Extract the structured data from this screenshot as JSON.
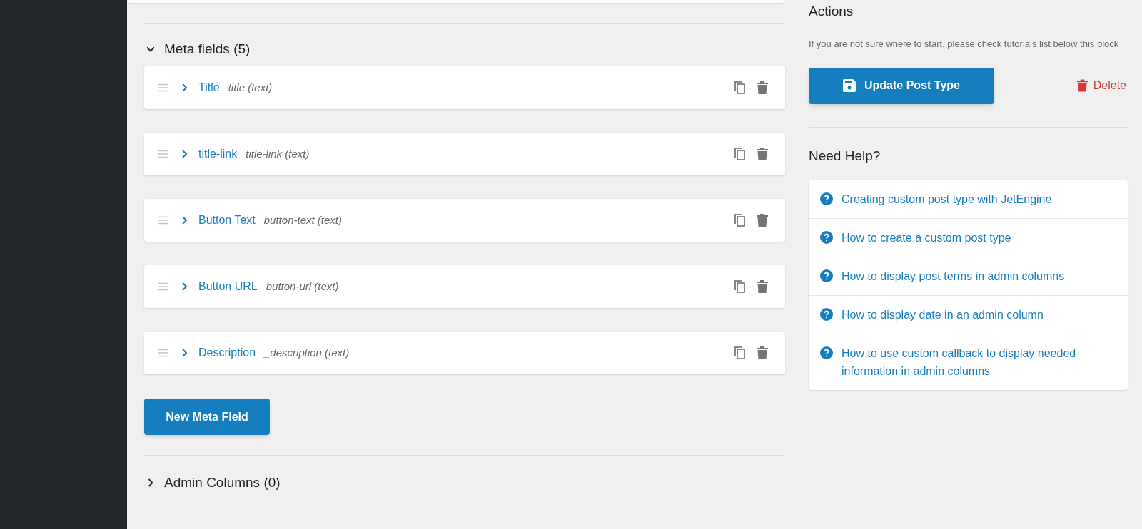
{
  "meta_fields": {
    "heading": "Meta fields (5)",
    "expanded": true,
    "fields": [
      {
        "label": "Title",
        "name": "title (text)"
      },
      {
        "label": "title-link",
        "name": "title-link (text)"
      },
      {
        "label": "Button Text",
        "name": "button-text (text)"
      },
      {
        "label": "Button URL",
        "name": "button-url (text)"
      },
      {
        "label": "Description",
        "name": "_description (text)"
      }
    ],
    "new_button": "New Meta Field"
  },
  "admin_columns": {
    "heading": "Admin Columns (0)",
    "expanded": false
  },
  "actions": {
    "heading": "Actions",
    "description": "If you are not sure where to start, please check tutorials list below this block",
    "update_button": "Update Post Type",
    "delete_link": "Delete"
  },
  "help": {
    "heading": "Need Help?",
    "links": [
      "Creating custom post type with JetEngine",
      "How to create a custom post type",
      "How to display post terms in admin columns",
      "How to display date in an admin column",
      "How to use custom callback to display needed information in admin columns"
    ]
  }
}
